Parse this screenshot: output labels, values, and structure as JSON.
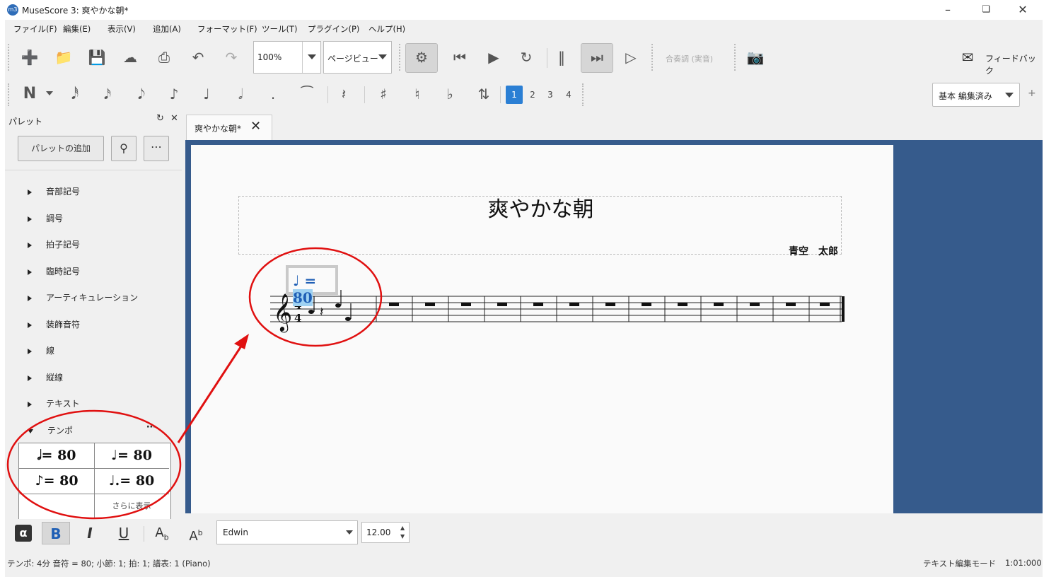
{
  "window": {
    "title": "MuseScore 3: 爽やかな朝*",
    "logo": "m3"
  },
  "menu": [
    "ファイル(F)",
    "編集(E)",
    "表示(V)",
    "追加(A)",
    "フォーマット(F)",
    "ツール(T)",
    "プラグイン(P)",
    "ヘルプ(H)"
  ],
  "toolbar": {
    "zoom": "100%",
    "view_mode": "ページビュー",
    "concert_pitch": "合奏調 (実音)",
    "feedback": "フィードバック",
    "workspace": "基本 編集済み",
    "voices": [
      "1",
      "2",
      "3",
      "4"
    ]
  },
  "palette": {
    "title": "パレット",
    "add_button": "パレットの追加",
    "categories": [
      "音部記号",
      "調号",
      "拍子記号",
      "臨時記号",
      "アーティキュレーション",
      "装飾音符",
      "線",
      "縦線",
      "テキスト",
      "テンポ"
    ],
    "tempo_items": [
      {
        "glyph": "𝅗𝅥",
        "text": "= 80"
      },
      {
        "glyph": "♩",
        "text": "= 80"
      },
      {
        "glyph": "♪",
        "text": "= 80"
      },
      {
        "glyph": "♩.",
        "text": "= 80"
      }
    ],
    "show_more": "さらに表示"
  },
  "score": {
    "tab_label": "爽やかな朝*",
    "title": "爽やかな朝",
    "composer": "青空　太郎",
    "tempo_note": "♩",
    "tempo_eq": " = ",
    "tempo_value": "80"
  },
  "text_toolbar": {
    "font": "Edwin",
    "size": "12.00"
  },
  "status": {
    "left": "テンポ: 4分 音符 = 80; 小節: 1; 拍: 1; 譜表: 1 (Piano)",
    "mode": "テキスト編集モード",
    "time": "1:01:000"
  },
  "colors": {
    "accent": "#2b7fd4",
    "score_bg": "#365b8c",
    "annotation": "#e01010",
    "tempo_text": "#1f5fb5",
    "selection": "#9fd2f2"
  }
}
